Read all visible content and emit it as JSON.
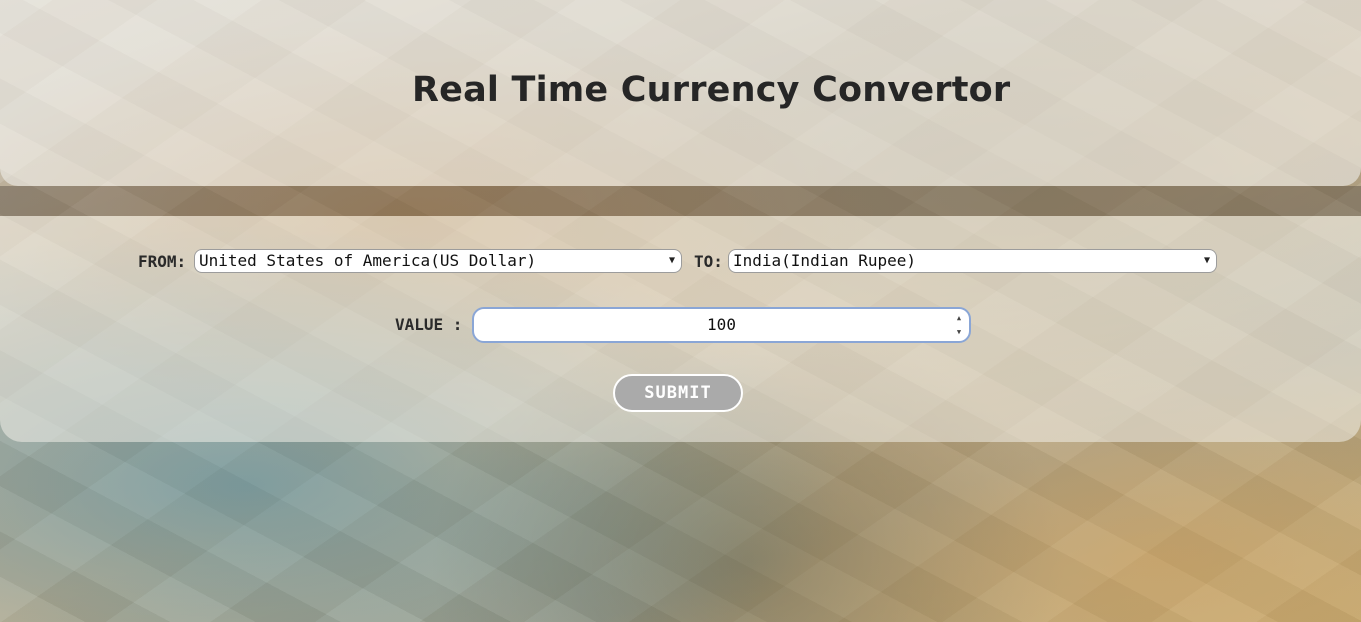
{
  "header": {
    "title": "Real Time Currency Convertor"
  },
  "form": {
    "from_label": "FROM:",
    "from_selected": "United States of America(US Dollar)",
    "to_label": "TO:",
    "to_selected": "India(Indian Rupee)",
    "value_label": "VALUE :",
    "value": "100",
    "submit_label": "SUBMIT"
  },
  "icons": {
    "dropdown_arrow": "▼",
    "spinner_up": "▲",
    "spinner_down": "▼"
  },
  "colors": {
    "title": "#262626",
    "submit_bg": "#aaaaaa",
    "input_focus_border": "#8aa6d6"
  }
}
